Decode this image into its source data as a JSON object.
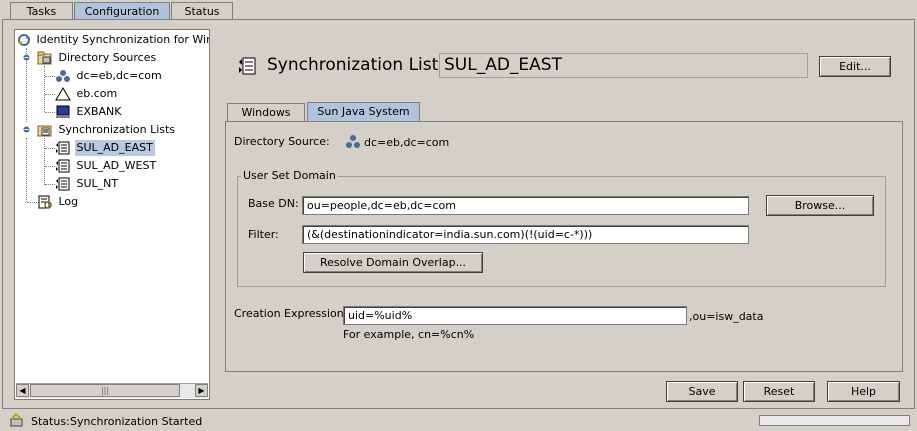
{
  "top_tabs": [
    {
      "label": "Tasks"
    },
    {
      "label": "Configuration"
    },
    {
      "label": "Status"
    }
  ],
  "tree": {
    "root": "Identity Synchronization for Windows",
    "directory_sources_label": "Directory Sources",
    "sources": [
      "dc=eb,dc=com",
      "eb.com",
      "EXBANK"
    ],
    "sync_lists_label": "Synchronization Lists",
    "lists": [
      "SUL_AD_EAST",
      "SUL_AD_WEST",
      "SUL_NT"
    ],
    "log_label": "Log",
    "scroll_thumb": "|||"
  },
  "header": {
    "label": "Synchronization List:",
    "name_value": "SUL_AD_EAST",
    "edit_button": "Edit..."
  },
  "inner_tabs": [
    {
      "label": "Windows"
    },
    {
      "label": "Sun Java System"
    }
  ],
  "directory_source": {
    "label": "Directory Source:",
    "value": "dc=eb,dc=com"
  },
  "user_set_domain": {
    "legend": "User Set Domain",
    "base_dn_label": "Base DN:",
    "base_dn_value": "ou=people,dc=eb,dc=com",
    "browse_button": "Browse...",
    "filter_label": "Filter:",
    "filter_value": "(&(destinationindicator=india.sun.com)(!(uid=c-*)))",
    "resolve_button": "Resolve Domain Overlap..."
  },
  "creation": {
    "label": "Creation Expression:",
    "value": "uid=%uid%",
    "suffix": ",ou=isw_data",
    "example": "For example, cn=%cn%"
  },
  "footer_buttons": {
    "save": "Save",
    "reset": "Reset",
    "help": "Help"
  },
  "status": {
    "label": "Status:",
    "value": "Synchronization Started"
  },
  "colors": {
    "selected_tab": "#b0c4de",
    "panel": "#d4d0c8"
  }
}
